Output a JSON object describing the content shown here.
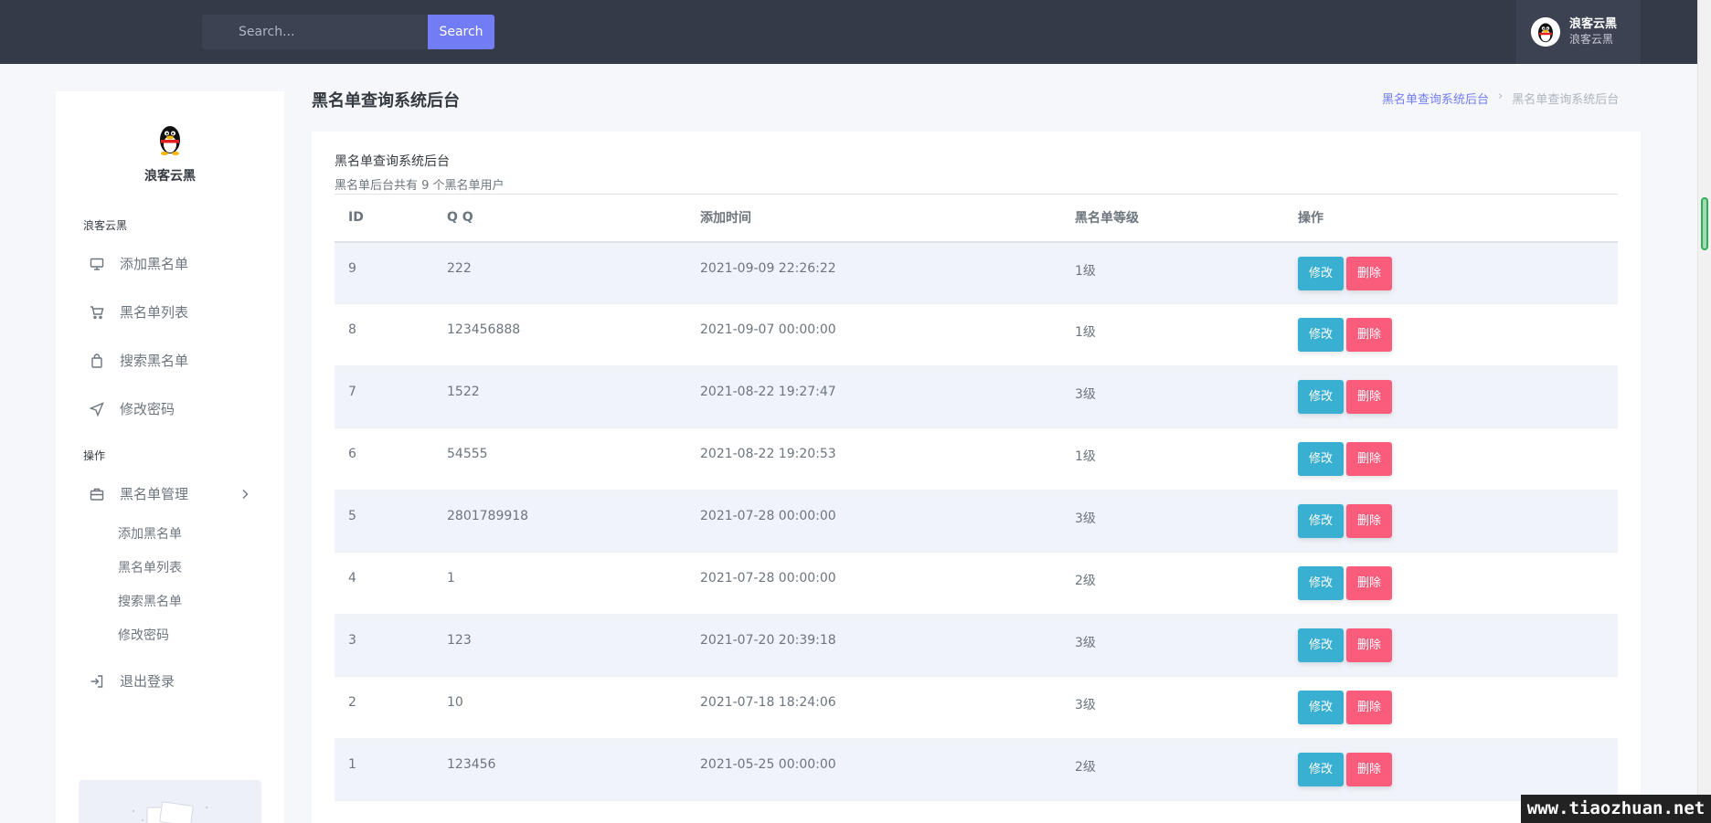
{
  "search": {
    "placeholder": "Search...",
    "button_label": "Search"
  },
  "user": {
    "name": "浪客云黑",
    "subtitle": "浪客云黑"
  },
  "sidebar": {
    "profile_name": "浪客云黑",
    "section1_title": "浪客云黑",
    "items": [
      {
        "label": "添加黑名单",
        "icon": "monitor-icon"
      },
      {
        "label": "黑名单列表",
        "icon": "cart-icon"
      },
      {
        "label": "搜索黑名单",
        "icon": "bag-icon"
      },
      {
        "label": "修改密码",
        "icon": "navigation-icon"
      }
    ],
    "section2_title": "操作",
    "group": {
      "label": "黑名单管理",
      "icon": "briefcase-icon",
      "sub_items": [
        "添加黑名单",
        "黑名单列表",
        "搜索黑名单",
        "修改密码"
      ]
    },
    "logout_label": "退出登录"
  },
  "page": {
    "title": "黑名单查询系统后台",
    "breadcrumb": [
      "黑名单查询系统后台",
      "黑名单查询系统后台"
    ]
  },
  "card": {
    "title": "黑名单查询系统后台",
    "subtitle": "黑名单后台共有 9 个黑名单用户"
  },
  "table": {
    "headers": [
      "ID",
      "Q Q",
      "添加时间",
      "黑名单等级",
      "操作"
    ],
    "edit_label": "修改",
    "delete_label": "删除",
    "rows": [
      {
        "id": "9",
        "qq": "222",
        "time": "2021-09-09 22:26:22",
        "level": "1级"
      },
      {
        "id": "8",
        "qq": "123456888",
        "time": "2021-09-07 00:00:00",
        "level": "1级"
      },
      {
        "id": "7",
        "qq": "1522",
        "time": "2021-08-22 19:27:47",
        "level": "3级"
      },
      {
        "id": "6",
        "qq": "54555",
        "time": "2021-08-22 19:20:53",
        "level": "1级"
      },
      {
        "id": "5",
        "qq": "2801789918",
        "time": "2021-07-28 00:00:00",
        "level": "3级"
      },
      {
        "id": "4",
        "qq": "1",
        "time": "2021-07-28 00:00:00",
        "level": "2级"
      },
      {
        "id": "3",
        "qq": "123",
        "time": "2021-07-20 20:39:18",
        "level": "3级"
      },
      {
        "id": "2",
        "qq": "10",
        "time": "2021-07-18 18:24:06",
        "level": "3级"
      },
      {
        "id": "1",
        "qq": "123456",
        "time": "2021-05-25 00:00:00",
        "level": "2级"
      }
    ]
  },
  "watermark": "www.tiaozhuan.net",
  "colors": {
    "topbar": "#353a48",
    "primary": "#727cf5",
    "info": "#39afd1",
    "danger": "#fa5c7c"
  }
}
